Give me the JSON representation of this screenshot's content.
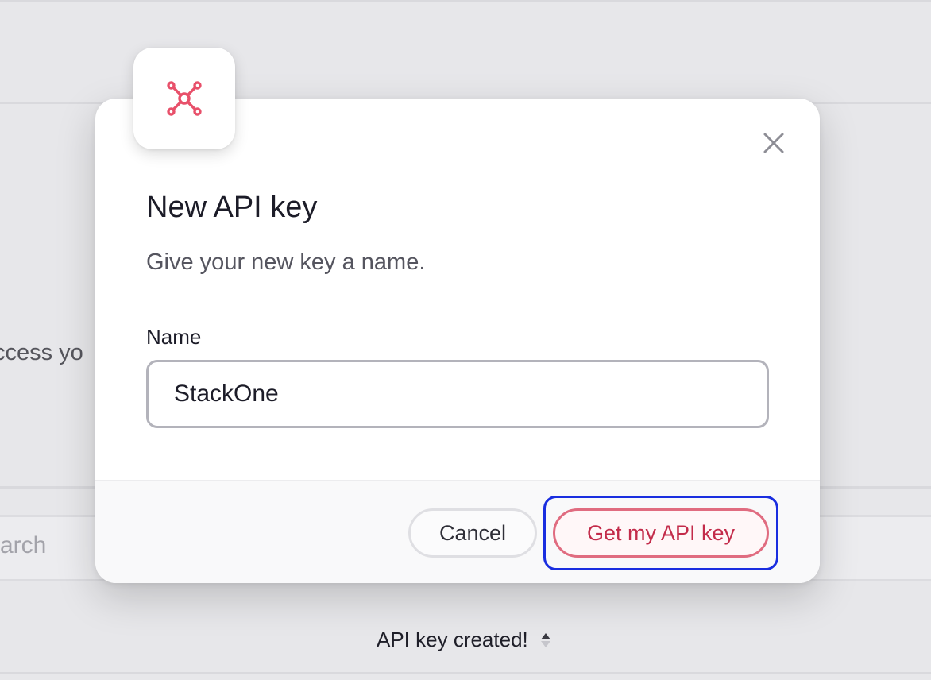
{
  "background": {
    "partial_text": "ccess yo",
    "search_placeholder": "arch",
    "toast_message": "API key created!"
  },
  "modal": {
    "icon": "network-nodes-icon",
    "close_icon": "close-icon",
    "title": "New API key",
    "subtitle": "Give your new key a name.",
    "name_label": "Name",
    "name_value": "StackOne",
    "cancel_label": "Cancel",
    "submit_label": "Get my API key"
  },
  "colors": {
    "accent": "#e8506a",
    "focus_ring": "#1a2ee0",
    "primary_text": "#c32b4a"
  }
}
